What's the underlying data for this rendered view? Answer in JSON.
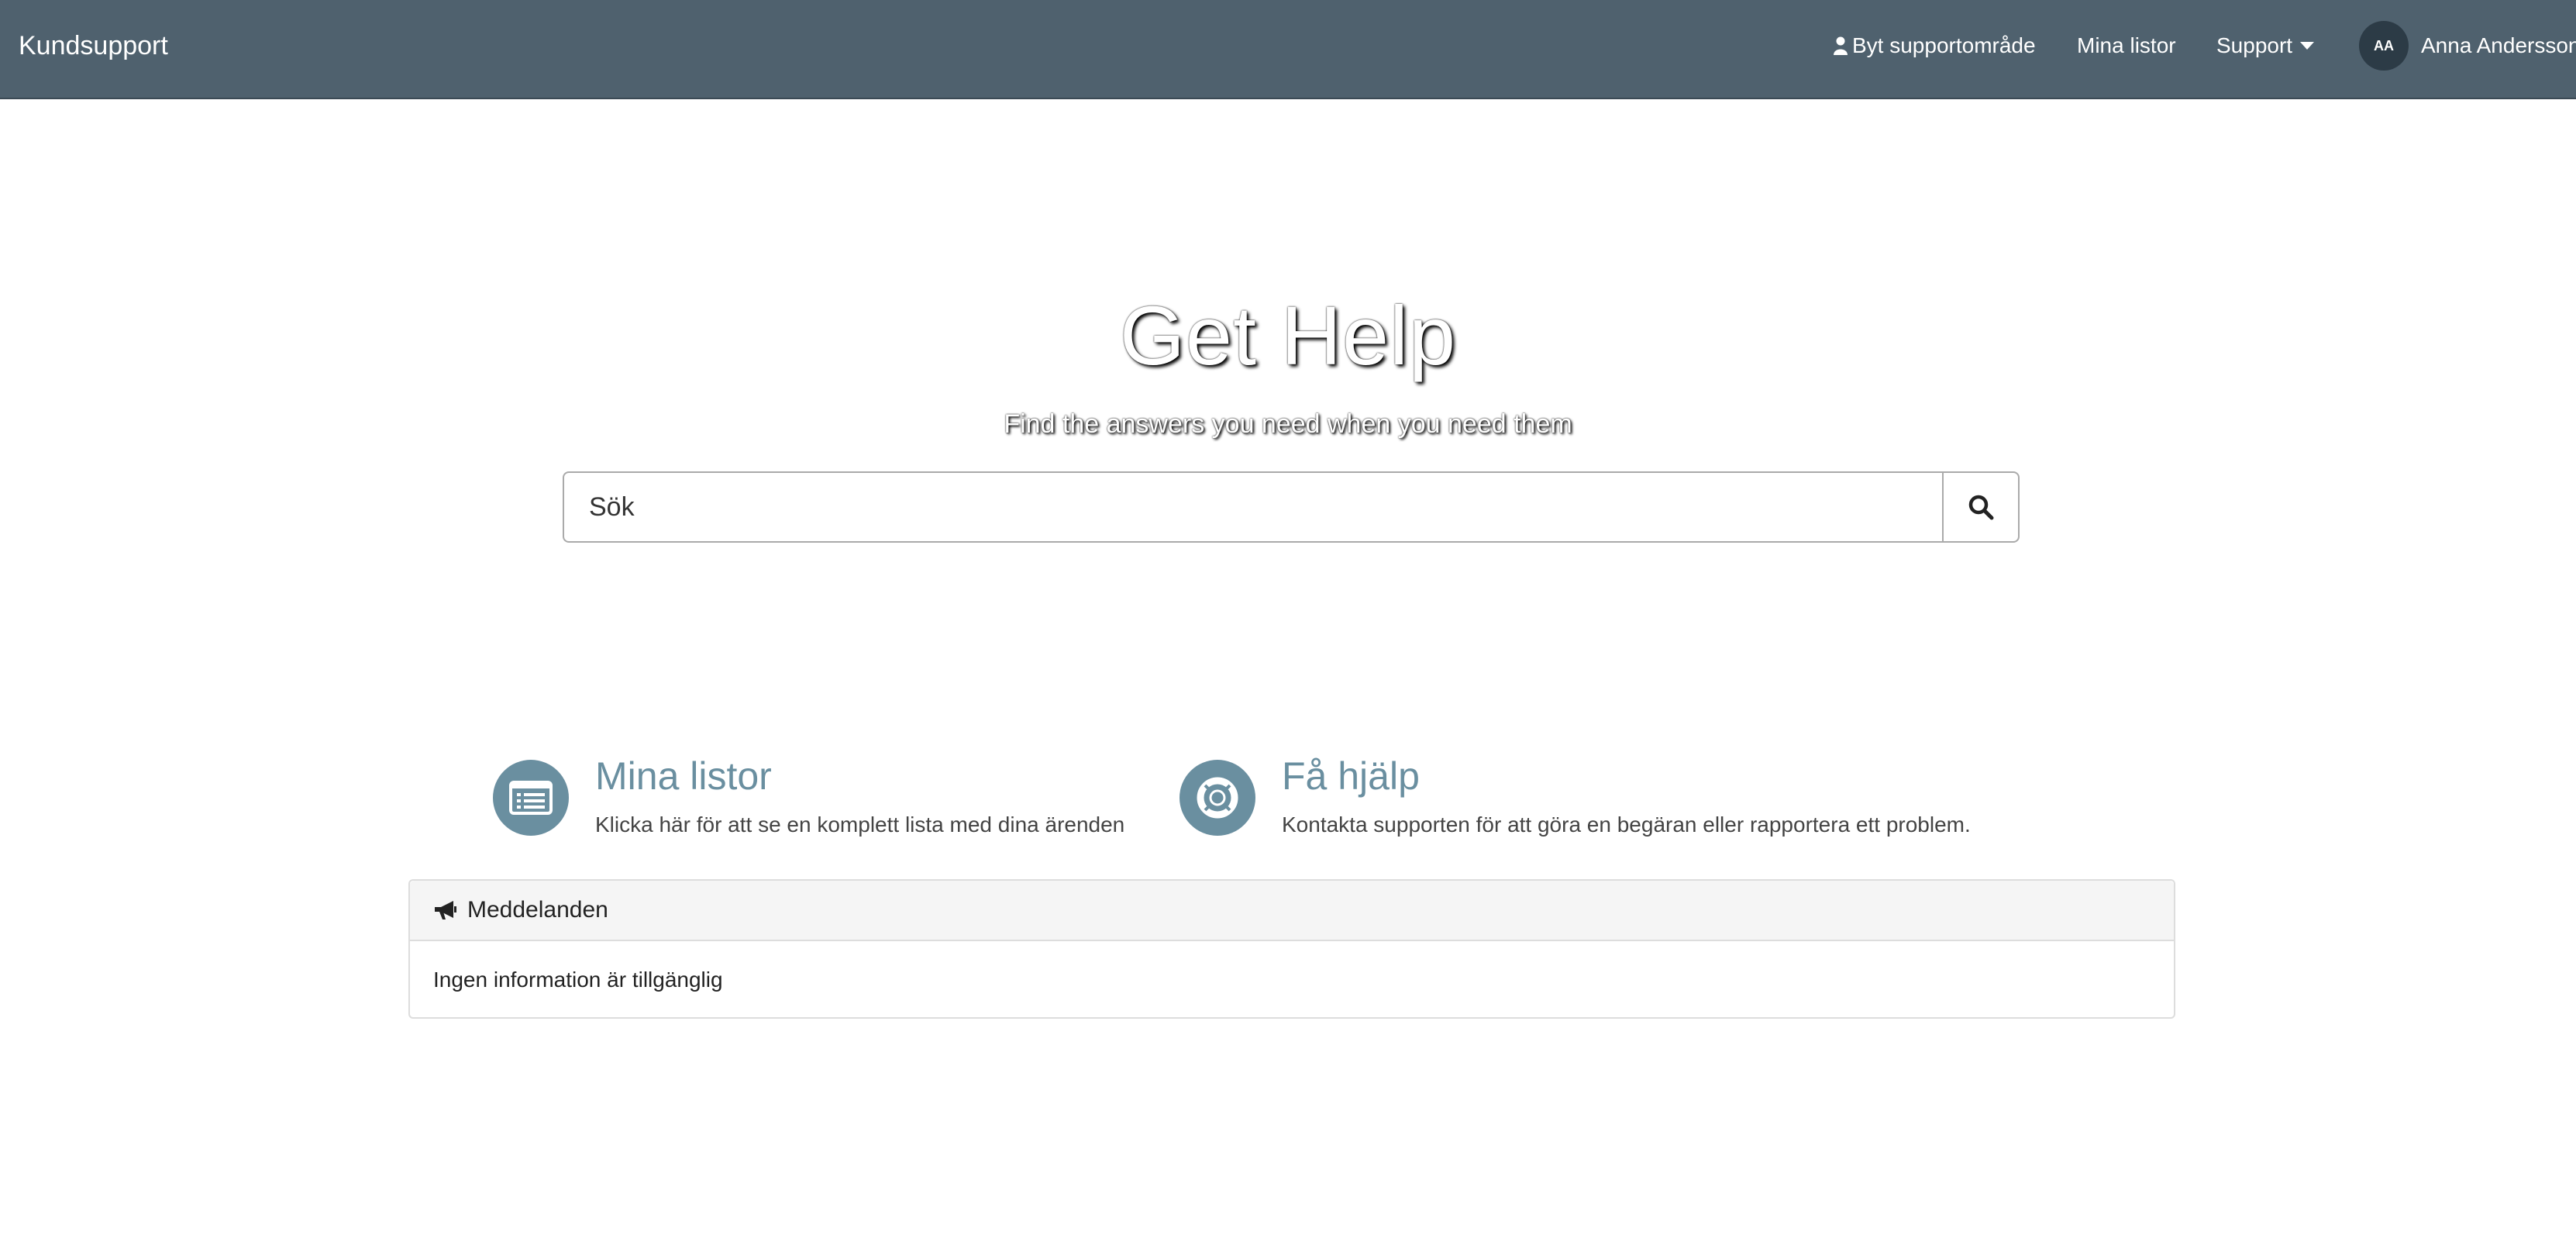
{
  "navbar": {
    "brand": "Kundsupport",
    "switch_area": "Byt supportområde",
    "my_lists": "Mina listor",
    "support": "Support",
    "user_initials": "AA",
    "user_name": "Anna Andersson",
    "background_color": "#4f616e"
  },
  "hero": {
    "title": "Get Help",
    "subtitle": "Find the answers you need when you need them"
  },
  "search": {
    "placeholder": "Sök",
    "button_icon": "search-icon"
  },
  "quick_links": [
    {
      "icon": "list-icon",
      "title": "Mina listor",
      "description": "Klicka här för att se en komplett lista med dina ärenden"
    },
    {
      "icon": "lifebuoy-icon",
      "title": "Få hjälp",
      "description": "Kontakta supporten för att göra en begäran eller rapportera ett problem."
    }
  ],
  "messages": {
    "icon": "megaphone-icon",
    "title": "Meddelanden",
    "body": "Ingen information är tillgänglig"
  },
  "colors": {
    "accent": "#6a8fa0",
    "panel_header": "#f5f5f5"
  }
}
